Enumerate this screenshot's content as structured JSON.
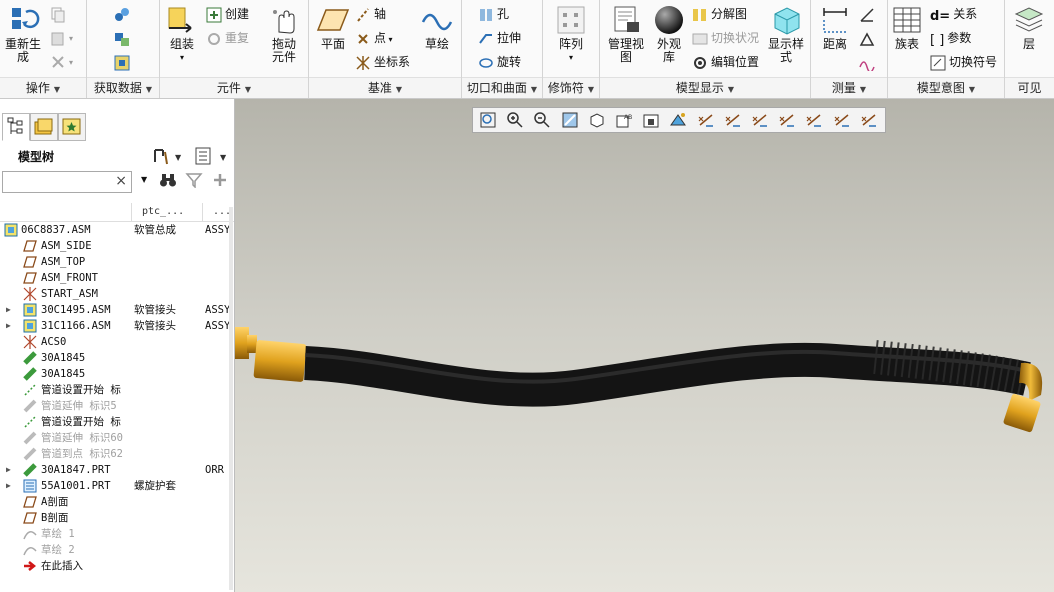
{
  "ribbon": {
    "groups": [
      {
        "label": "操作"
      },
      {
        "label": "获取数据"
      },
      {
        "label": "元件"
      },
      {
        "label": "基准"
      },
      {
        "label": "切口和曲面"
      },
      {
        "label": "修饰符"
      },
      {
        "label": "模型显示"
      },
      {
        "label": "测量"
      },
      {
        "label": "模型意图"
      },
      {
        "label": "可见"
      }
    ],
    "regenerate": {
      "line1": "重新生",
      "line2": "成"
    },
    "assemble": "组装",
    "create": "创建",
    "repeat": "重复",
    "drag_components": {
      "line1": "拖动",
      "line2": "元件"
    },
    "plane": "平面",
    "axis": "轴",
    "point": "点",
    "coord_sys": "坐标系",
    "sketch": "草绘",
    "hole": "孔",
    "extrude": "拉伸",
    "revolve": "旋转",
    "pattern": "阵列",
    "manage_views": {
      "line1": "管理视",
      "line2": "图"
    },
    "appearance": {
      "line1": "外观",
      "line2": "库"
    },
    "exploded_view": "分解图",
    "toggle_status": "切换状况",
    "edit_position": "编辑位置",
    "display_style": {
      "line1": "显示样",
      "line2": "式"
    },
    "distance": "距离",
    "family_table": "族表",
    "relations": "关系",
    "parameters": "参数",
    "switch_symbols": "切换符号",
    "layers": "层"
  },
  "model_tree": {
    "title": "模型树",
    "search_clear": "×",
    "columns": [
      "ptc_...",
      "..."
    ],
    "rows": [
      {
        "name": "06C8837.ASM",
        "c2": "软管总成",
        "c3": "ASSY",
        "icon": "assembly-icon",
        "expand": ""
      },
      {
        "name": "ASM_SIDE",
        "c2": "",
        "c3": "",
        "icon": "datum-plane-icon",
        "expand": ""
      },
      {
        "name": "ASM_TOP",
        "c2": "",
        "c3": "",
        "icon": "datum-plane-icon",
        "expand": ""
      },
      {
        "name": "ASM_FRONT",
        "c2": "",
        "c3": "",
        "icon": "datum-plane-icon",
        "expand": ""
      },
      {
        "name": "START_ASM",
        "c2": "",
        "c3": "",
        "icon": "coordinate-system-icon",
        "expand": ""
      },
      {
        "name": "30C1495.ASM",
        "c2": "软管接头",
        "c3": "ASSY",
        "icon": "assembly-icon",
        "expand": "▶"
      },
      {
        "name": "31C1166.ASM",
        "c2": "软管接头",
        "c3": "ASSY",
        "icon": "assembly-icon",
        "expand": "▶"
      },
      {
        "name": "ACS0",
        "c2": "",
        "c3": "",
        "icon": "coordinate-system-icon",
        "expand": ""
      },
      {
        "name": "30A1845",
        "c2": "",
        "c3": "",
        "icon": "hose-part-icon",
        "expand": ""
      },
      {
        "name": "30A1845",
        "c2": "",
        "c3": "",
        "icon": "hose-part-icon",
        "expand": ""
      },
      {
        "name": "管道设置开始 标",
        "c2": "",
        "c3": "",
        "icon": "pipe-start-icon",
        "expand": ""
      },
      {
        "name": "管道延伸 标识5",
        "c2": "",
        "c3": "",
        "icon": "pipe-extend-icon",
        "expand": ""
      },
      {
        "name": "管道设置开始 标",
        "c2": "",
        "c3": "",
        "icon": "pipe-start-icon",
        "expand": ""
      },
      {
        "name": "管道延伸 标识60",
        "c2": "",
        "c3": "",
        "icon": "pipe-extend-icon",
        "expand": ""
      },
      {
        "name": "管道到点 标识62",
        "c2": "",
        "c3": "",
        "icon": "pipe-extend-icon",
        "expand": ""
      },
      {
        "name": "30A1847.PRT",
        "c2": "",
        "c3": "ORR",
        "icon": "hose-part-icon",
        "expand": "▶"
      },
      {
        "name": "55A1001.PRT",
        "c2": "螺旋护套",
        "c3": "",
        "icon": "spring-part-icon",
        "expand": "▶"
      },
      {
        "name": "A剖面",
        "c2": "",
        "c3": "",
        "icon": "datum-plane-icon",
        "expand": ""
      },
      {
        "name": "B剖面",
        "c2": "",
        "c3": "",
        "icon": "datum-plane-icon",
        "expand": ""
      },
      {
        "name": "草绘 1",
        "c2": "",
        "c3": "",
        "icon": "sketch-icon",
        "expand": ""
      },
      {
        "name": "草绘 2",
        "c2": "",
        "c3": "",
        "icon": "sketch-icon",
        "expand": ""
      },
      {
        "name": "在此插入",
        "c2": "",
        "c3": "",
        "icon": "insert-here-arrow-icon",
        "expand": ""
      }
    ]
  },
  "colors": {
    "hose": "#121212",
    "fitting": "#e0a21e",
    "accent_blue": "#2b6fb5"
  }
}
